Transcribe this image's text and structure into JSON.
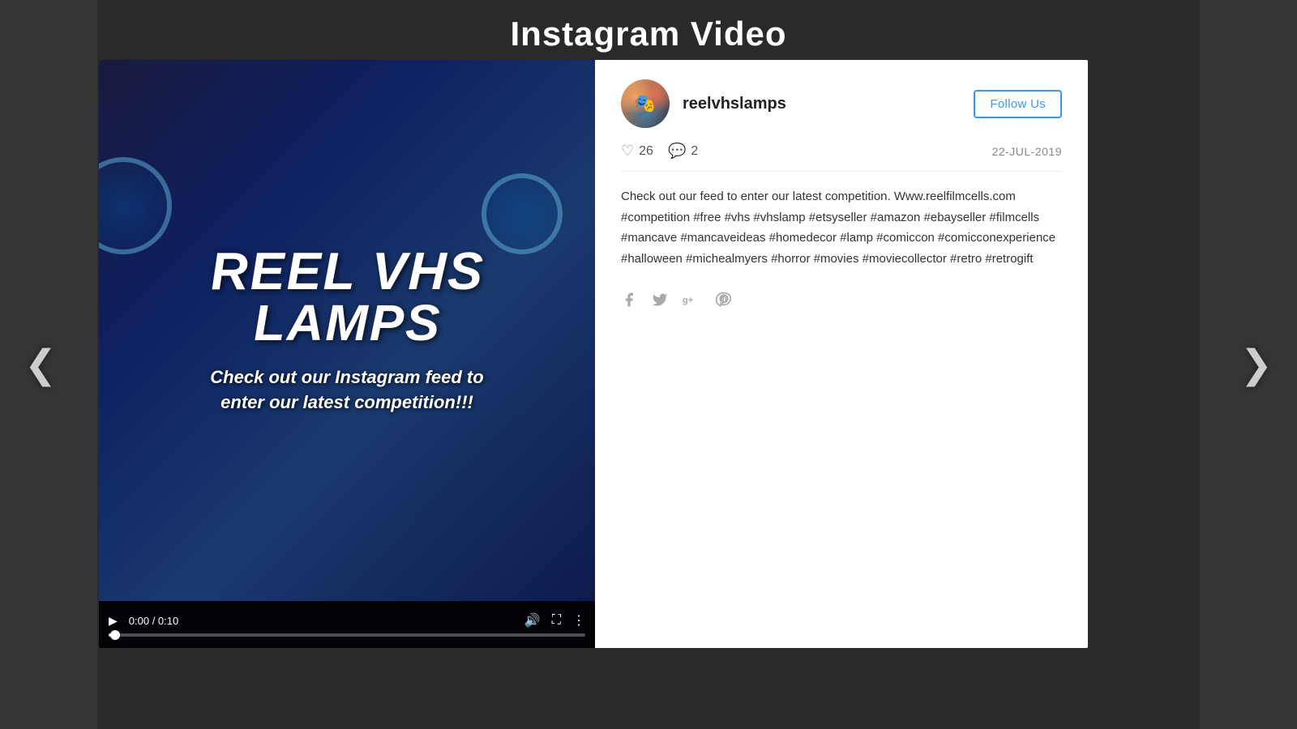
{
  "page": {
    "title": "Instagram Video",
    "background_color": "#2a2a2a"
  },
  "card": {
    "profile": {
      "username": "reelvhslamps",
      "avatar_emoji": "🎭",
      "follow_button": "Follow Us",
      "date": "22-JUL-2019"
    },
    "stats": {
      "likes_count": "26",
      "comments_count": "2",
      "likes_icon": "♡",
      "comments_icon": "💬"
    },
    "caption": "Check out our feed to enter our latest competition. Www.reelfilmcells.com #competition #free #vhs #vhslamp #etsyseller #amazon #ebayseller #filmcells #mancave #mancaveideas #homedecor #lamp #comiccon #comicconexperience #halloween #michealmyers #horror #movies #moviecollector #retro #retrogift",
    "video": {
      "title_line1": "REEL VHS",
      "title_line2": "LAMPS",
      "subtitle": "Check out our Instagram feed to enter our latest competition!!!",
      "time_current": "0:00",
      "time_total": "0:10",
      "time_display": "0:00 / 0:10"
    },
    "social_share": {
      "facebook_icon": "f",
      "twitter_icon": "t",
      "googleplus_icon": "g+",
      "pinterest_icon": "p"
    }
  },
  "navigation": {
    "prev_arrow": "❮",
    "next_arrow": "❯"
  }
}
